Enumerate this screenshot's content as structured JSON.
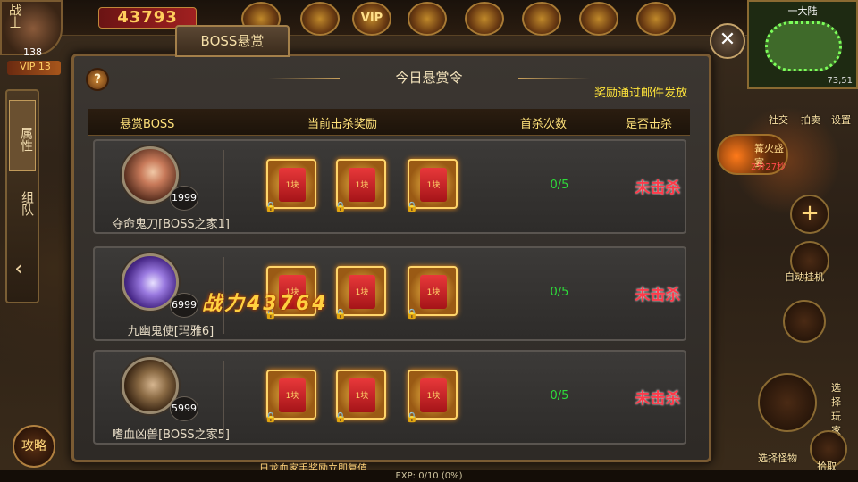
{
  "hud": {
    "role_char": "战士",
    "level": "138",
    "vip": "VIP 13",
    "power": "43793",
    "top_icons": [
      "",
      "",
      "VIP",
      "",
      "",
      "",
      ""
    ],
    "minimap_title": "一大陆",
    "coords": "73,51",
    "event_title": "篝火盛宴",
    "event_time": "2分27秒",
    "auto_battle": "自动挂机",
    "select_player": "选择玩家",
    "select_monster": "选择怪物",
    "pickup": "拾取",
    "strategy": "攻略",
    "small_icons": [
      "社交",
      "拍卖",
      "设置"
    ],
    "exp": "EXP: 0/10 (0%)",
    "bottom_notice": "日龙血家手奖励立即复值"
  },
  "left_tabs": {
    "attr": "属性",
    "team": "组队",
    "collapse": "‹"
  },
  "dialog": {
    "tab_label": "BOSS悬赏",
    "title": "今日悬赏令",
    "mail_note": "奖励通过邮件发放",
    "help": "?",
    "close": "✕",
    "headers": {
      "boss": "悬赏BOSS",
      "reward": "当前击杀奖励",
      "first_kill": "首杀次数",
      "killed": "是否击杀"
    }
  },
  "rows": [
    {
      "name": "夺命鬼刀[BOSS之家1]",
      "level": "1999",
      "count": "0/5",
      "status": "未击杀",
      "reward_label": "1块"
    },
    {
      "name": "九幽鬼使[玛雅6]",
      "level": "6999",
      "count": "0/5",
      "status": "未击杀",
      "reward_label": "1块"
    },
    {
      "name": "嗜血凶兽[BOSS之家5]",
      "level": "5999",
      "count": "0/5",
      "status": "未击杀",
      "reward_label": "1块"
    }
  ],
  "combat_float": "战力43764",
  "colors": {
    "header_text": "#ffe27a",
    "mail_note": "#ffe43a",
    "count_green": "#2edc3a",
    "status_red": "#ff3a4a"
  }
}
